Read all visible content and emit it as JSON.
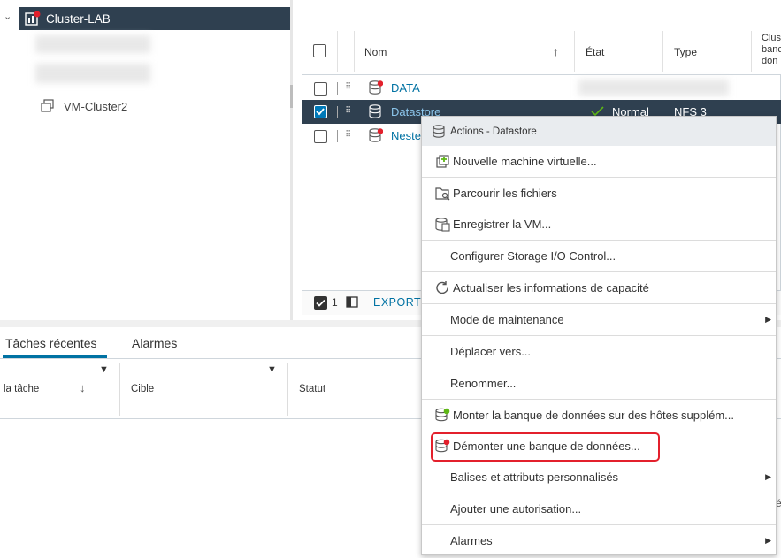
{
  "tree": {
    "cluster_label": "Cluster-LAB",
    "vm_cluster_label": "VM-Cluster2"
  },
  "grid": {
    "headers": {
      "name": "Nom",
      "state": "État",
      "type": "Type",
      "cluster": [
        "Clus",
        "banc",
        "don"
      ]
    },
    "rows": [
      {
        "name": "DATA",
        "state": "",
        "type": "",
        "checked": false
      },
      {
        "name": "Datastore",
        "state": "Normal",
        "type": "NFS 3",
        "checked": true
      },
      {
        "name": "Neste",
        "state": "",
        "type": "",
        "checked": false
      }
    ],
    "footer": {
      "count": "1",
      "export": "EXPORT"
    }
  },
  "tabs": {
    "recent": "Tâches récentes",
    "alarms": "Alarmes"
  },
  "tasks": {
    "col_task": "la tâche",
    "col_target": "Cible",
    "col_status": "Statut",
    "edge_text": "é"
  },
  "menu": {
    "title": "Actions - Datastore",
    "items": [
      {
        "label": "Nouvelle machine virtuelle..."
      },
      {
        "label": "Parcourir les fichiers"
      },
      {
        "label": "Enregistrer la VM..."
      },
      {
        "label": "Configurer Storage I/O Control..."
      },
      {
        "label": "Actualiser les informations de capacité"
      },
      {
        "label": "Mode de maintenance"
      },
      {
        "label": "Déplacer vers..."
      },
      {
        "label": "Renommer..."
      },
      {
        "label": "Monter la banque de données sur des hôtes supplém..."
      },
      {
        "label": "Démonter une banque de données..."
      },
      {
        "label": "Balises et attributs personnalisés"
      },
      {
        "label": "Ajouter une autorisation..."
      },
      {
        "label": "Alarmes"
      }
    ]
  },
  "colors": {
    "selected_row": "#2f4050",
    "link": "#0072a3",
    "highlight": "#e3202c",
    "accent_tab": "#0072a3"
  },
  "icons": [
    "cluster-icon",
    "vm-cluster-icon",
    "datastore-icon",
    "sort-up-icon",
    "sort-down-icon",
    "filter-icon",
    "check-icon",
    "new-vm-icon",
    "browse-files-icon",
    "register-vm-icon",
    "refresh-icon",
    "mount-datastore-icon",
    "unmount-datastore-icon",
    "submenu-arrow-icon",
    "columns-icon"
  ]
}
